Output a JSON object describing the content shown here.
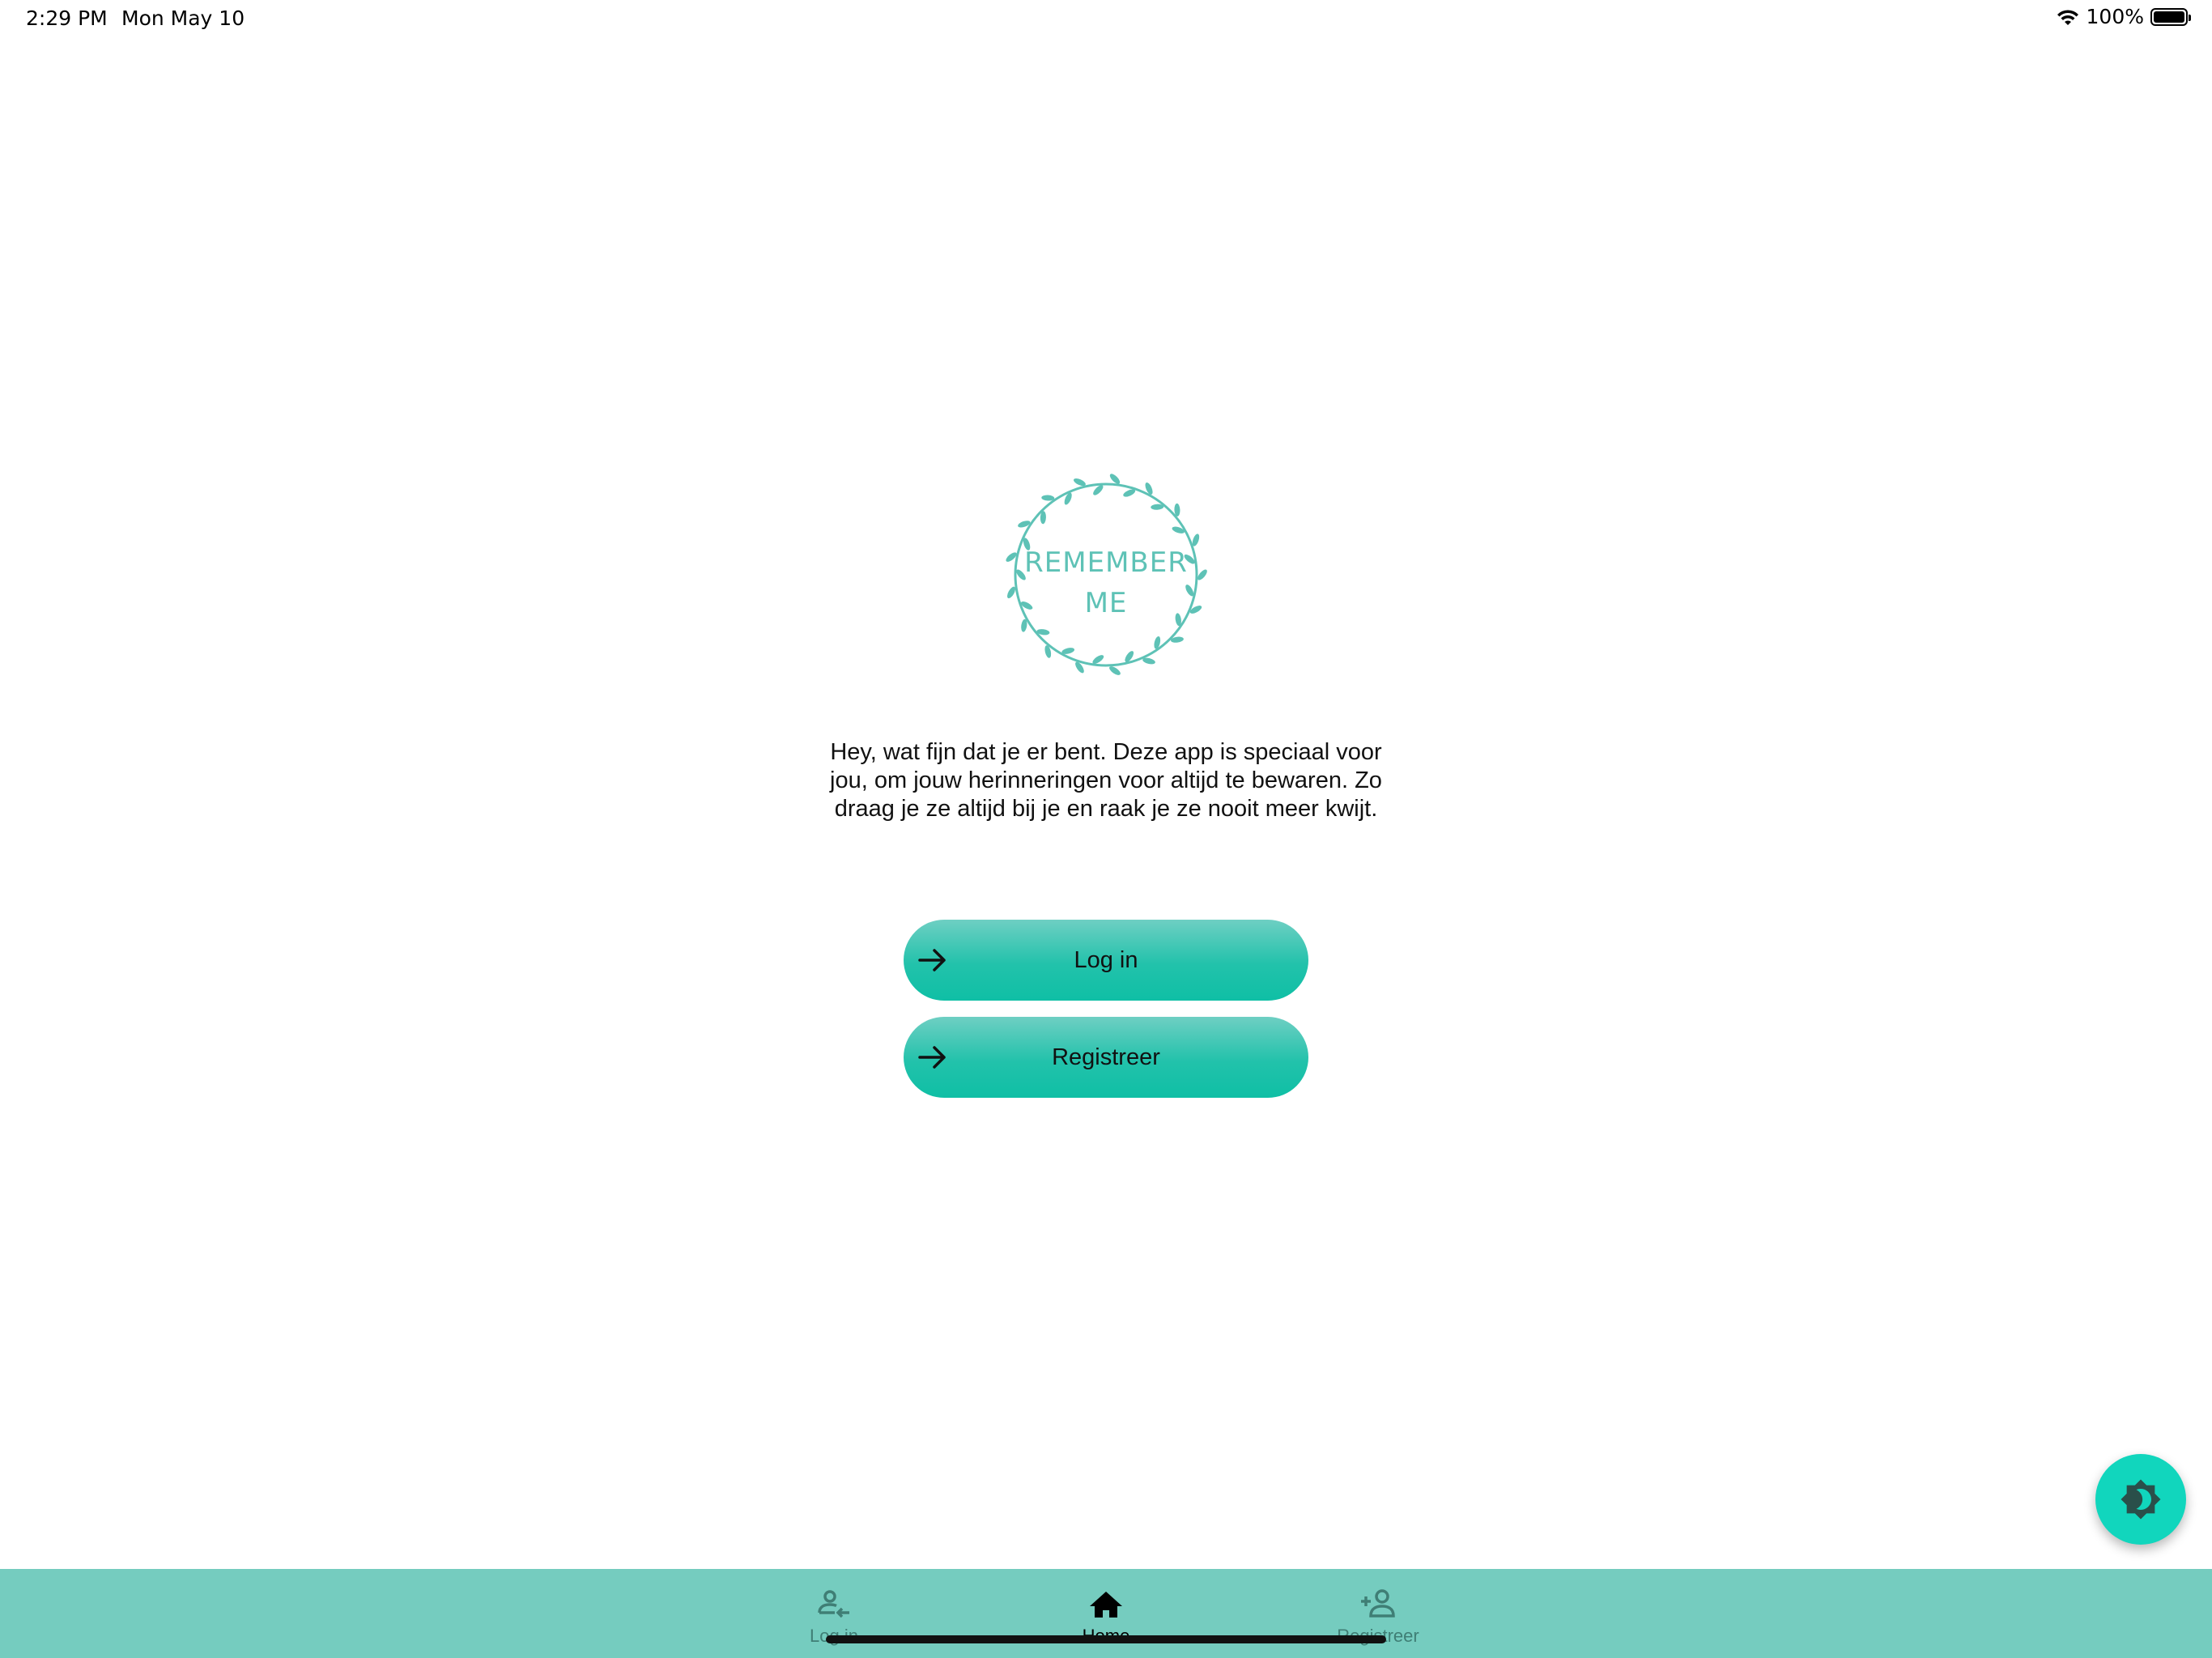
{
  "status_bar": {
    "time": "2:29 PM",
    "date": "Mon May 10",
    "battery": "100%"
  },
  "logo": {
    "line1": "REMEMBER",
    "line2": "ME",
    "color": "#5ec2b6"
  },
  "intro": {
    "text": "Hey, wat fijn dat je er bent. Deze app is speciaal voor jou, om jouw herinneringen voor altijd te bewaren. Zo draag je ze altijd bij je en raak je ze nooit meer kwijt."
  },
  "buttons": {
    "login_label": "Log in",
    "register_label": "Registreer",
    "accent": "#1cc2aa"
  },
  "fab": {
    "icon": "brightness-icon",
    "color": "#11d6bd"
  },
  "bottom_nav": {
    "background": "#75ccbf",
    "items": [
      {
        "label": "Log in",
        "icon": "login-person-icon",
        "active": false
      },
      {
        "label": "Home",
        "icon": "home-icon",
        "active": true
      },
      {
        "label": "Registreer",
        "icon": "add-person-icon",
        "active": false
      }
    ]
  }
}
